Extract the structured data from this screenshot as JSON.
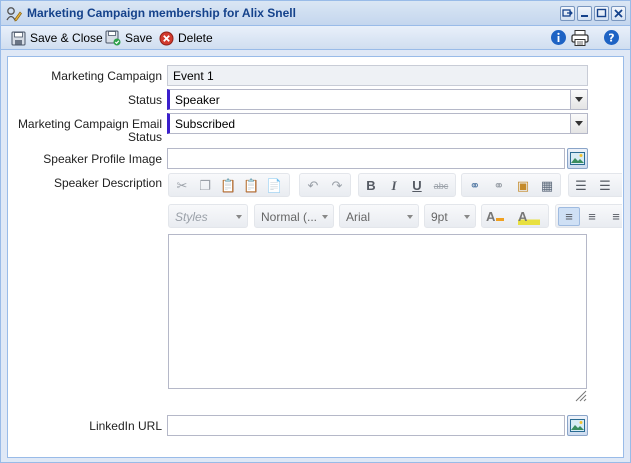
{
  "window": {
    "title": "Marketing Campaign membership for Alix Snell",
    "icon": "user-edit-icon",
    "tools": [
      "restore-icon",
      "minimize-icon",
      "maximize-icon",
      "close-icon"
    ]
  },
  "toolbar": {
    "save_close_label": "Save & Close",
    "save_label": "Save",
    "delete_label": "Delete",
    "right_icons": [
      "info-icon",
      "print-icon",
      "help-icon"
    ]
  },
  "form": {
    "campaign": {
      "label": "Marketing Campaign",
      "value": "Event 1"
    },
    "status": {
      "label": "Status",
      "value": "Speaker"
    },
    "email_status": {
      "label_line1": "Marketing Campaign Email",
      "label_line2": "Status",
      "value": "Subscribed"
    },
    "profile_image": {
      "label": "Speaker Profile Image",
      "value": ""
    },
    "description": {
      "label": "Speaker Description",
      "value": ""
    },
    "linkedin": {
      "label": "LinkedIn URL",
      "value": ""
    }
  },
  "editor": {
    "styles_label": "Styles",
    "format_label": "Normal (...",
    "font_label": "Arial",
    "size_label": "9pt",
    "bold_glyph": "B",
    "italic_glyph": "I",
    "underline_glyph": "U",
    "strike_glyph": "abc"
  }
}
